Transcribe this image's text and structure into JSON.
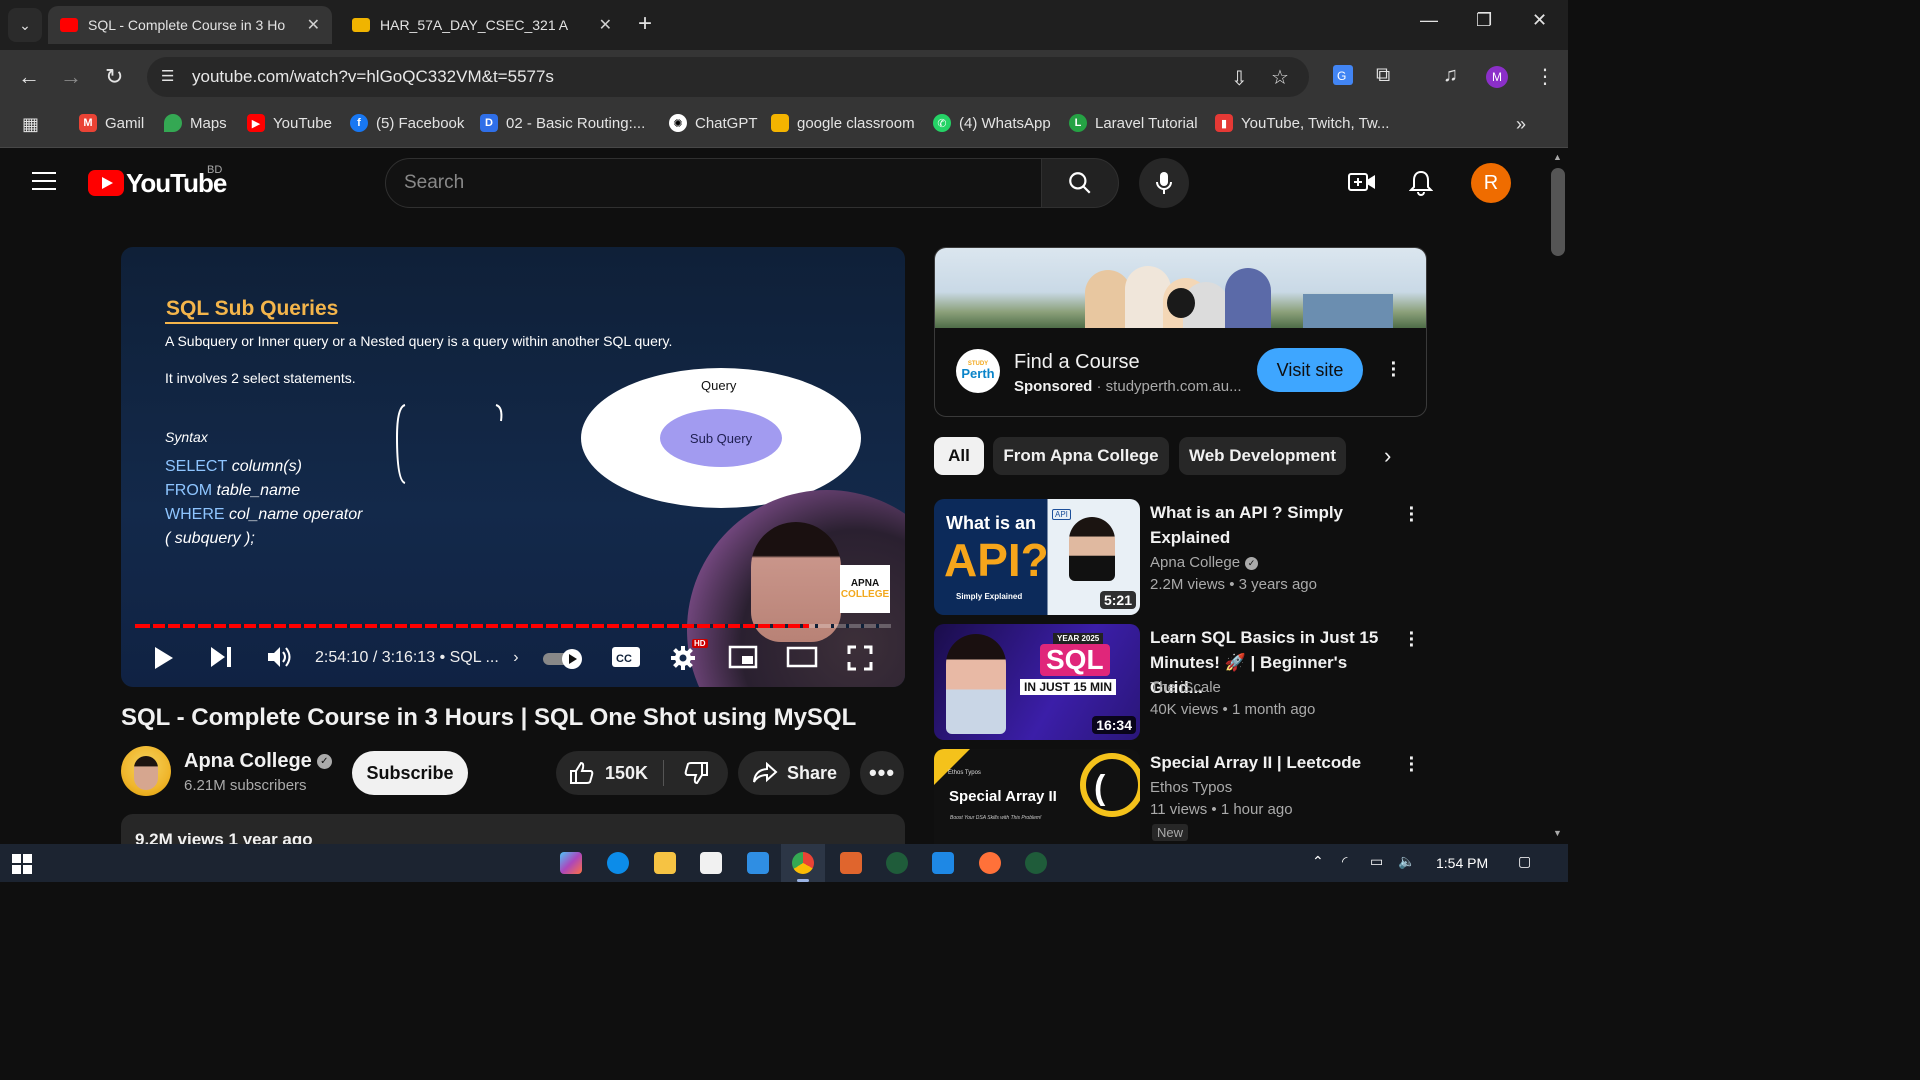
{
  "browser": {
    "tabs": [
      {
        "title": "SQL - Complete Course in 3 Ho",
        "active": true,
        "favicon_color": "#ff0000"
      },
      {
        "title": "HAR_57A_DAY_CSEC_321 A",
        "active": false,
        "favicon_color": "#f0b400"
      }
    ],
    "url": "youtube.com/watch?v=hlGoQC332VM&t=5577s",
    "profile_initial": "M",
    "bookmarks": [
      {
        "label": "Gamil",
        "icon": "gmail-icon",
        "color": "#ea4335"
      },
      {
        "label": "Maps",
        "icon": "maps-icon",
        "color": "#34a853"
      },
      {
        "label": "YouTube",
        "icon": "youtube-icon",
        "color": "#ff0000"
      },
      {
        "label": "(5) Facebook",
        "icon": "facebook-icon",
        "color": "#1877f2"
      },
      {
        "label": "02 - Basic Routing:...",
        "icon": "laravel-doc-icon",
        "color": "#2f6fe8"
      },
      {
        "label": "ChatGPT",
        "icon": "chatgpt-icon",
        "color": "#ffffff"
      },
      {
        "label": "google classroom",
        "icon": "classroom-icon",
        "color": "#f4b400"
      },
      {
        "label": "(4) WhatsApp",
        "icon": "whatsapp-icon",
        "color": "#25d366"
      },
      {
        "label": "Laravel Tutorial",
        "icon": "laravel-icon",
        "color": "#25a244"
      },
      {
        "label": "YouTube, Twitch, Tw...",
        "icon": "chart-icon",
        "color": "#e53935"
      }
    ]
  },
  "youtube": {
    "logo_text": "YouTube",
    "country": "BD",
    "search_placeholder": "Search",
    "account_initial": "R"
  },
  "player": {
    "slide": {
      "title": "SQL Sub Queries",
      "line1": "A Subquery or Inner query or a Nested query is a query within another SQL query.",
      "line2": "It involves 2 select statements.",
      "syntax_label": "Syntax",
      "code": [
        {
          "kw": "SELECT",
          "rest": " column(s)"
        },
        {
          "kw": "FROM",
          "rest": " table_name"
        },
        {
          "kw": "WHERE",
          "rest": " col_name operator"
        },
        {
          "kw": "",
          "rest": "( subquery );"
        }
      ],
      "outer_label": "Query",
      "inner_label": "Sub Query",
      "badge_line1": "APNA",
      "badge_line2": "COLLEGE"
    },
    "progress_fraction": 0.892,
    "timecode": "2:54:10 / 3:16:13",
    "chapter": "• SQL ...",
    "hd_badge": "HD",
    "cc_label": "CC"
  },
  "video": {
    "title": "SQL - Complete Course in 3 Hours | SQL One Shot using MySQL",
    "channel": "Apna College",
    "subscribers": "6.21M subscribers",
    "subscribe_label": "Subscribe",
    "likes": "150K",
    "share_label": "Share",
    "views_date": "9.2M views  1 year ago"
  },
  "ad": {
    "title": "Find a Course",
    "sponsored": "Sponsored",
    "domain": "· studyperth.com.au...",
    "cta": "Visit site",
    "logo_small": "STUDY",
    "logo_text": "Perth"
  },
  "chips": [
    "All",
    "From Apna College",
    "Web Development"
  ],
  "recommendations": [
    {
      "title": "What is an API ? Simply Explained",
      "channel": "Apna College",
      "verified": true,
      "meta": "2.2M views  • 3 years ago",
      "duration": "5:21",
      "thumb_text1": "What is an",
      "thumb_text2": "API?",
      "thumb_text3": "Simply Explained"
    },
    {
      "title": "Learn SQL Basics in Just 15 Minutes! 🚀 | Beginner's Guid...",
      "channel": "The iScale",
      "verified": false,
      "meta": "40K views  • 1 month ago",
      "duration": "16:34",
      "thumb_text1": "YEAR 2025",
      "thumb_text2": "SQL",
      "thumb_text3": "IN JUST 15 MIN"
    },
    {
      "title": "Special Array II | Leetcode",
      "channel": "Ethos Typos",
      "verified": false,
      "meta": "11 views  • 1 hour ago",
      "duration": "",
      "badge": "New",
      "thumb_text1": "Special Array II",
      "thumb_text2": "Ethos Typos",
      "thumb_text3": "Boost Your DSA Skills with This Problem!"
    }
  ],
  "taskbar": {
    "time": "1:54 PM"
  }
}
